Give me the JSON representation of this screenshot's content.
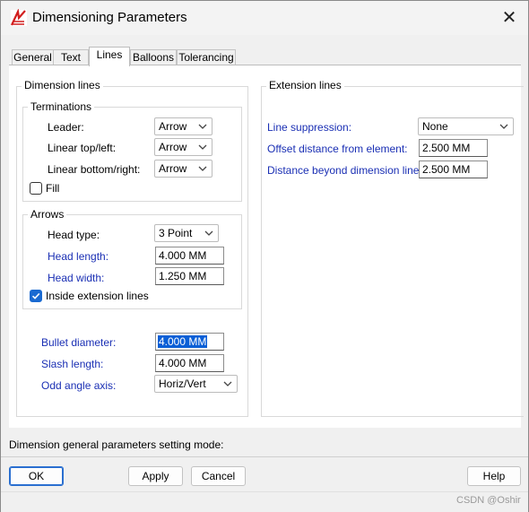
{
  "window": {
    "title": "Dimensioning Parameters",
    "close_symbol": "✕"
  },
  "tabs": [
    {
      "label": "General",
      "active": false
    },
    {
      "label": "Text",
      "active": false
    },
    {
      "label": "Lines",
      "active": true
    },
    {
      "label": "Balloons",
      "active": false
    },
    {
      "label": "Tolerancing",
      "active": false
    }
  ],
  "dimension_lines": {
    "title": "Dimension lines",
    "terminations": {
      "title": "Terminations",
      "leader_label": "Leader:",
      "leader_value": "Arrow",
      "linear_top_label": "Linear top/left:",
      "linear_top_value": "Arrow",
      "linear_bottom_label": "Linear bottom/right:",
      "linear_bottom_value": "Arrow",
      "fill_label": "Fill",
      "fill_checked": false
    },
    "arrows": {
      "title": "Arrows",
      "head_type_label": "Head type:",
      "head_type_value": "3 Point",
      "head_length_label": "Head length:",
      "head_length_value": "4.000 MM",
      "head_width_label": "Head width:",
      "head_width_value": "1.250 MM",
      "inside_label": "Inside extension lines",
      "inside_checked": true
    },
    "bullet_label": "Bullet diameter:",
    "bullet_value": "4.000 MM",
    "slash_label": "Slash length:",
    "slash_value": "4.000 MM",
    "odd_label": "Odd angle axis:",
    "odd_value": "Horiz/Vert"
  },
  "extension_lines": {
    "title": "Extension lines",
    "suppression_label": "Line suppression:",
    "suppression_value": "None",
    "offset_label": "Offset distance from element:",
    "offset_value": "2.500 MM",
    "beyond_label": "Distance beyond dimension line:",
    "beyond_value": "2.500 MM"
  },
  "status_text": "Dimension general parameters setting mode:",
  "buttons": {
    "ok": "OK",
    "apply": "Apply",
    "cancel": "Cancel",
    "help": "Help"
  },
  "watermark": "CSDN @Oshir",
  "colors": {
    "label_blue": "#1a2fb4",
    "accent": "#1a6ad1"
  }
}
